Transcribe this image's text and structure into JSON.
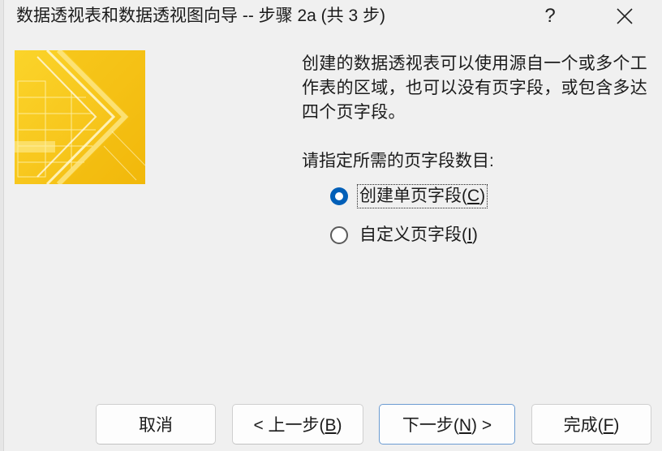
{
  "window": {
    "title": "数据透视表和数据透视图向导 -- 步骤 2a (共 3 步)",
    "help_glyph": "?",
    "help_icon": "question-mark-icon",
    "close_icon": "close-x-icon"
  },
  "main": {
    "description": "创建的数据透视表可以使用源自一个或多个工作表的区域，也可以没有页字段，或包含多达四个页字段。",
    "prompt": "请指定所需的页字段数目:",
    "options": [
      {
        "pre": "创建单页字段(",
        "key": "C",
        "post": ")",
        "checked": true
      },
      {
        "pre": "自定义页字段(",
        "key": "I",
        "post": ")",
        "checked": false
      }
    ]
  },
  "buttons": {
    "cancel": {
      "text": "取消"
    },
    "back": {
      "pre": "< 上一步(",
      "key": "B",
      "post": ")"
    },
    "next": {
      "pre": "下一步(",
      "key": "N",
      "post": ") >"
    },
    "finish": {
      "pre": "完成(",
      "key": "F",
      "post": ")"
    }
  },
  "colors": {
    "accent": "#005fb8",
    "banner_yellow": "#f7c61c",
    "background": "#f0f0f0"
  }
}
